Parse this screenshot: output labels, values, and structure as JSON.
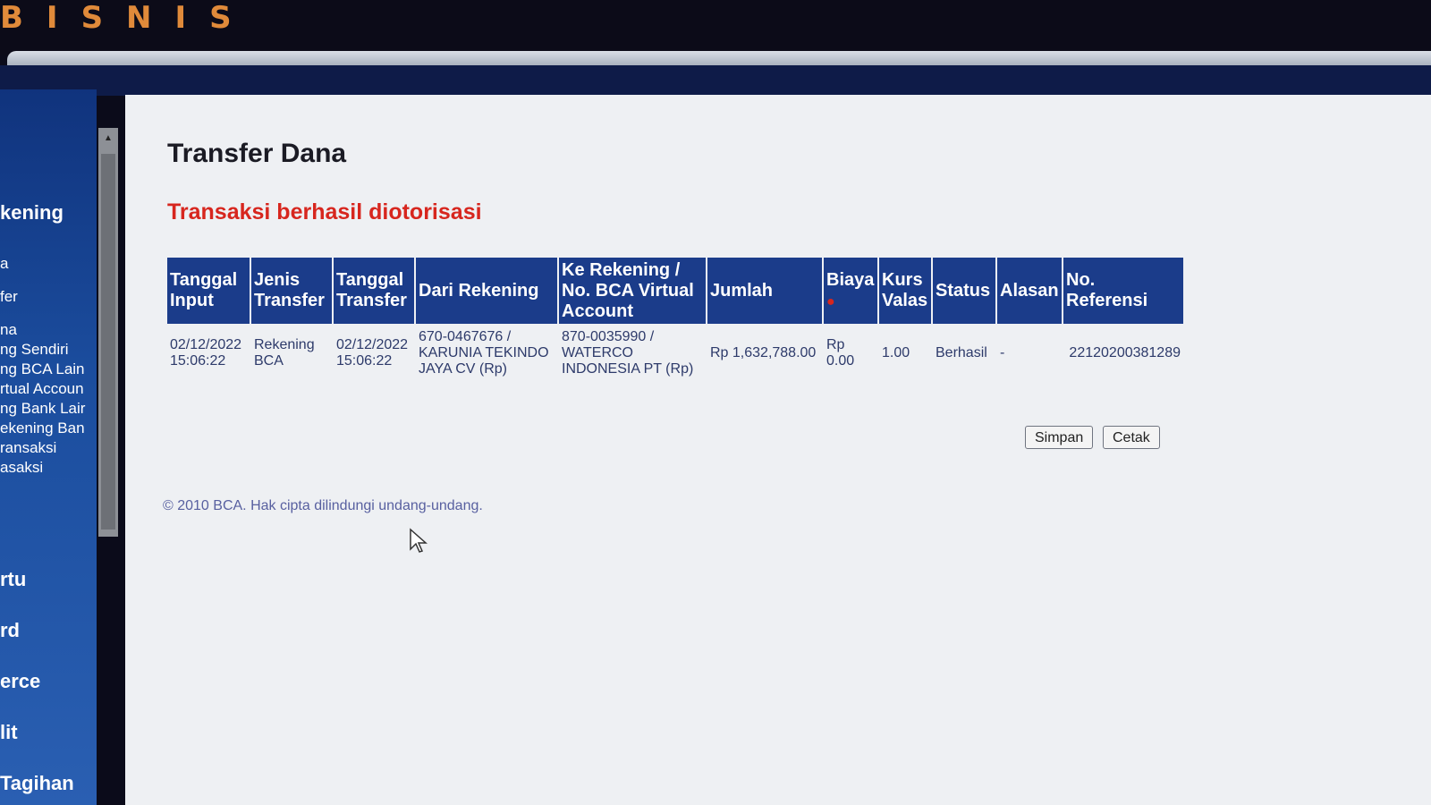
{
  "header": {
    "brand": "BISNIS"
  },
  "sidebar": {
    "group1": "kening",
    "items": [
      "a",
      "fer",
      "na",
      "ng Sendiri",
      "ng BCA Lain",
      "rtual Accoun",
      "ng Bank Lair",
      "ekening Ban",
      "ransaksi",
      "asaksi"
    ],
    "group2": "rtu",
    "group3": "rd",
    "group4": "erce",
    "group5": "lit",
    "group6": "Tagihan"
  },
  "page": {
    "title": "Transfer Dana",
    "success_message": "Transaksi berhasil diotorisasi"
  },
  "table": {
    "headers": {
      "tanggal_input": "Tanggal Input",
      "jenis_transfer": "Jenis Transfer",
      "tanggal_transfer": "Tanggal Transfer",
      "dari_rekening": "Dari Rekening",
      "ke_rekening": "Ke Rekening / No. BCA Virtual Account",
      "jumlah": "Jumlah",
      "biaya": "Biaya",
      "kurs_valas": "Kurs Valas",
      "status": "Status",
      "alasan": "Alasan",
      "no_referensi": "No. Referensi"
    },
    "row": {
      "tanggal_input": "02/12/2022 15:06:22",
      "jenis_transfer": "Rekening BCA",
      "tanggal_transfer": "02/12/2022 15:06:22",
      "dari_rekening": "670-0467676 / KARUNIA TEKINDO JAYA CV (Rp)",
      "ke_rekening": "870-0035990 / WATERCO INDONESIA PT (Rp)",
      "jumlah": "Rp 1,632,788.00",
      "biaya": "Rp 0.00",
      "kurs_valas": "1.00",
      "status": "Berhasil",
      "alasan": "-",
      "no_referensi": "22120200381289"
    }
  },
  "buttons": {
    "save": "Simpan",
    "print": "Cetak"
  },
  "footer": {
    "copyright": "© 2010 BCA. Hak cipta dilindungi undang-undang."
  },
  "colors": {
    "header_blue": "#1b3c8a",
    "accent_red": "#d7261e",
    "sidebar_blue": "#1b4d9e"
  }
}
